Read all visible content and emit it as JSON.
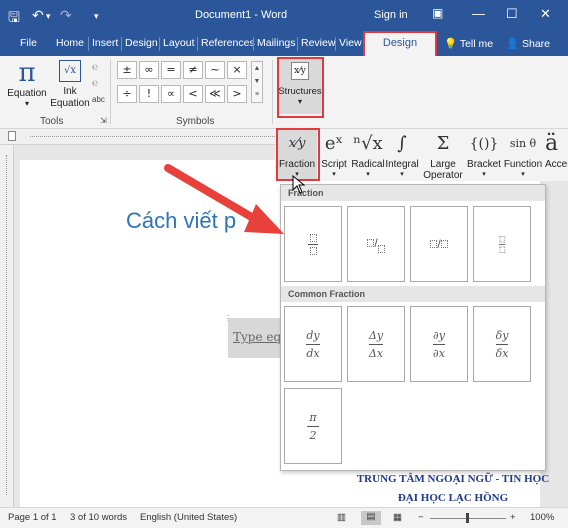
{
  "titlebar": {
    "doc_title": "Document1 - Word",
    "signin": "Sign in",
    "save_icon": "save-icon",
    "undo_icon": "undo-icon",
    "redo_icon": "redo-icon"
  },
  "tabs": {
    "file": "File",
    "home": "Home",
    "insert": "Insert",
    "design": "Design",
    "layout": "Layout",
    "references": "References",
    "mailings": "Mailings",
    "review": "Review",
    "view": "View",
    "design_active": "Design",
    "tellme": "Tell me",
    "share": "Share"
  },
  "ribbon": {
    "equation_label": "Equation",
    "ink_equation_label": "Ink Equation",
    "tools_label": "Tools",
    "symbols_label": "Symbols",
    "structures_label": "Structures",
    "symbols_row1": [
      "±",
      "∞",
      "=",
      "≠",
      "~",
      "×"
    ],
    "symbols_row2": [
      "÷",
      "!",
      "∝",
      "<",
      "≪",
      ">"
    ]
  },
  "structures": [
    {
      "label": "Fraction",
      "glyph": "x⁄y"
    },
    {
      "label": "Script",
      "glyph": "eˣ"
    },
    {
      "label": "Radical",
      "glyph": "ⁿ√x"
    },
    {
      "label": "Integral",
      "glyph": "∫"
    },
    {
      "label": "Large Operator",
      "glyph": "Σ"
    },
    {
      "label": "Bracket",
      "glyph": "{()}"
    },
    {
      "label": "Function",
      "glyph": "sin θ"
    },
    {
      "label": "Accent",
      "glyph": "ä"
    }
  ],
  "document": {
    "heading": "Cách viết p",
    "equation_placeholder": "Type eq"
  },
  "dropdown": {
    "fraction_header": "Fraction",
    "common_fraction_header": "Common Fraction",
    "common_fractions": [
      {
        "num": "dy",
        "den": "dx"
      },
      {
        "num": "Δy",
        "den": "Δx"
      },
      {
        "num": "∂y",
        "den": "∂x"
      },
      {
        "num": "δy",
        "den": "δx"
      },
      {
        "num": "π",
        "den": "2"
      }
    ]
  },
  "status": {
    "page": "Page 1 of 1",
    "words": "3 of 10 words",
    "language": "English (United States)",
    "zoom": "100%"
  },
  "watermark": {
    "line1": "TRUNG TÂM NGOẠI NGỮ - TIN HỌC",
    "line2": "ĐẠI HỌC LẠC HỒNG"
  },
  "colors": {
    "accent": "#2b579a",
    "highlight": "#e0393e",
    "heading": "#2e74b5"
  }
}
